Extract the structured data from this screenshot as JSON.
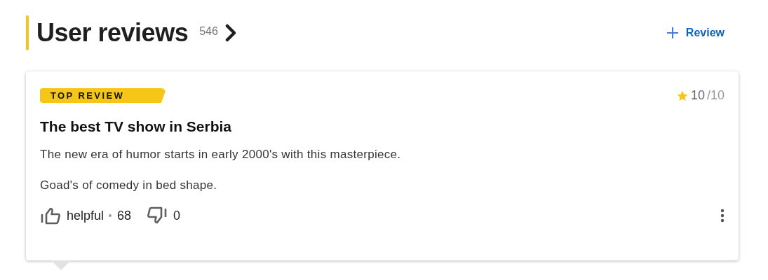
{
  "header": {
    "title": "User reviews",
    "count": "546",
    "add_button": "Review"
  },
  "review": {
    "badge": "TOP REVIEW",
    "rating": "10",
    "rating_max": "/10",
    "title": "The best TV show in Serbia",
    "paragraphs": [
      "The new era of humor starts in early 2000's with this masterpiece.",
      "Goad's of comedy in bed shape."
    ],
    "helpful_label": "helpful",
    "helpful_count": "68",
    "unhelpful_count": "0"
  }
}
